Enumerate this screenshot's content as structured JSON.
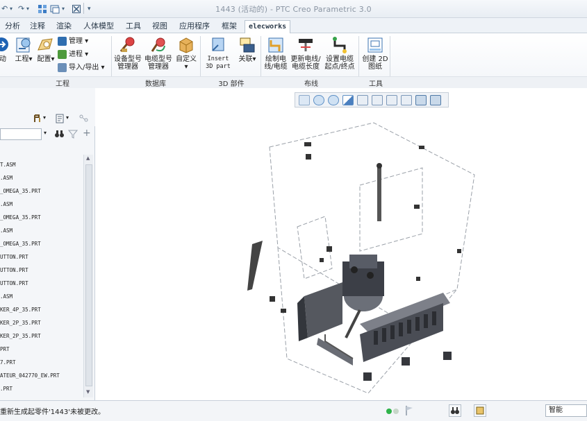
{
  "window": {
    "title": "1443 (活动的) - PTC Creo Parametric 3.0"
  },
  "quick_access": {
    "undo_glyph": "↶",
    "redo_glyph": "↷",
    "dropdown_glyph": "▾"
  },
  "tabs": [
    {
      "label": "分析"
    },
    {
      "label": "注释"
    },
    {
      "label": "渲染"
    },
    {
      "label": "人体模型"
    },
    {
      "label": "工具"
    },
    {
      "label": "视图"
    },
    {
      "label": "应用程序"
    },
    {
      "label": "框架"
    },
    {
      "label": "elecworks"
    }
  ],
  "ribbon": {
    "project_group": {
      "label": "工程",
      "buttons": [
        {
          "label": "动"
        },
        {
          "label": "工程"
        },
        {
          "label": "配置"
        }
      ],
      "small": [
        {
          "label": "管理"
        },
        {
          "label": "进程"
        },
        {
          "label": "导入/导出"
        }
      ]
    },
    "database_group": {
      "label": "数据库",
      "buttons": [
        {
          "label": "设备型号管理器"
        },
        {
          "label": "电缆型号管理器"
        },
        {
          "label": "自定义"
        }
      ]
    },
    "parts3d_group": {
      "label": "3D 部件",
      "buttons": [
        {
          "label": "Insert 3D part"
        },
        {
          "label": "关联"
        }
      ]
    },
    "routing_group": {
      "label": "布线",
      "buttons": [
        {
          "label": "绘制电线/电缆"
        },
        {
          "label": "更新电线/电缆长度"
        },
        {
          "label": "设置电缆起点/终点"
        }
      ]
    },
    "tools_group": {
      "label": "工具",
      "buttons": [
        {
          "label": "创建 2D 图纸"
        }
      ]
    }
  },
  "model_tree": {
    "items": [
      {
        "label": "T.ASM"
      },
      {
        "label": ".ASM"
      },
      {
        "label": "_OMEGA_35.PRT"
      },
      {
        "label": ".ASM"
      },
      {
        "label": "_OMEGA_35.PRT"
      },
      {
        "label": ".ASM"
      },
      {
        "label": "_OMEGA_35.PRT"
      },
      {
        "label": "UTTON.PRT"
      },
      {
        "label": "UTTON.PRT"
      },
      {
        "label": "UTTON.PRT"
      },
      {
        "label": ".ASM"
      },
      {
        "label": "KER_4P_35.PRT"
      },
      {
        "label": "KER_2P_35.PRT"
      },
      {
        "label": "KER_2P_35.PRT"
      },
      {
        "label": "PRT"
      },
      {
        "label": "7.PRT"
      },
      {
        "label": "ATEUR_042770_EW.PRT"
      },
      {
        "label": ".PRT"
      }
    ]
  },
  "status": {
    "message": "重新生成起零件'1443'未被更改。",
    "filter_value": "智能"
  },
  "colors": {
    "accent": "#2a6fb5",
    "ribbon_bg": "#f2f5f9",
    "status_green": "#2fb34a"
  }
}
